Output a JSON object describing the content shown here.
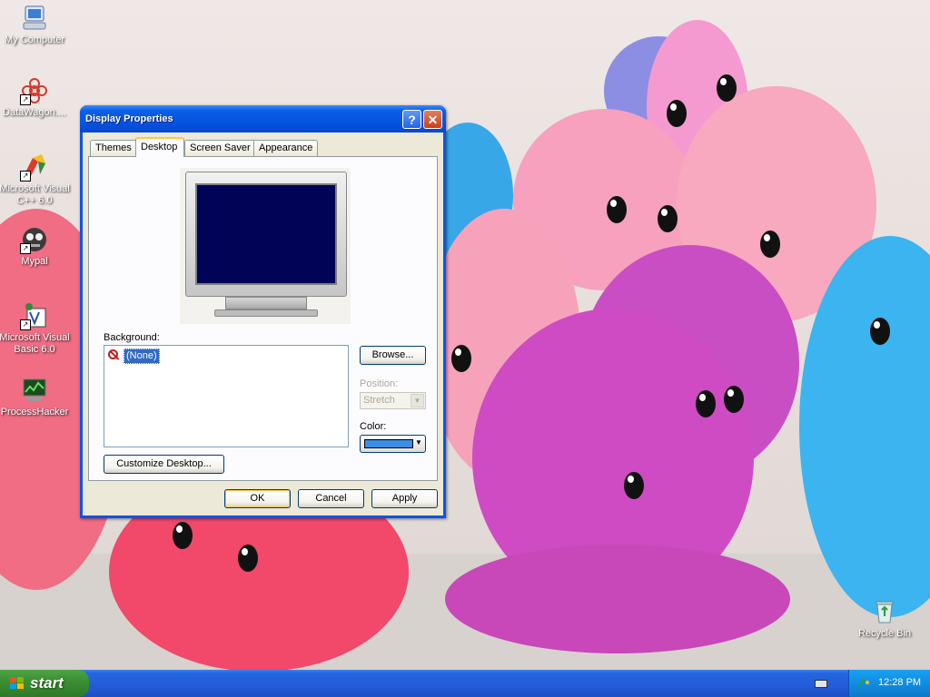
{
  "desktop": {
    "icons": [
      {
        "label": "My Computer"
      },
      {
        "label": "DataWagon...."
      },
      {
        "label": "Microsoft Visual C++ 6.0"
      },
      {
        "label": "Mypal"
      },
      {
        "label": "Microsoft Visual Basic 6.0"
      },
      {
        "label": "ProcessHacker"
      },
      {
        "label": "Recycle Bin"
      }
    ]
  },
  "window": {
    "title": "Display Properties",
    "help_glyph": "?",
    "close_glyph": "✕",
    "tabs": [
      {
        "label": "Themes",
        "active": false
      },
      {
        "label": "Desktop",
        "active": true
      },
      {
        "label": "Screen Saver",
        "active": false
      },
      {
        "label": "Appearance",
        "active": false
      }
    ],
    "background_label": "Background:",
    "background_items": [
      {
        "label": "(None)",
        "selected": true
      }
    ],
    "browse_button": "Browse...",
    "position_label": "Position:",
    "position_value": "Stretch",
    "color_label": "Color:",
    "color_value": "#3a8ee6",
    "screen_color": "#000356",
    "customize_button": "Customize Desktop...",
    "ok_button": "OK",
    "cancel_button": "Cancel",
    "apply_button": "Apply"
  },
  "taskbar": {
    "start_label": "start",
    "clock": "12:28 PM"
  }
}
